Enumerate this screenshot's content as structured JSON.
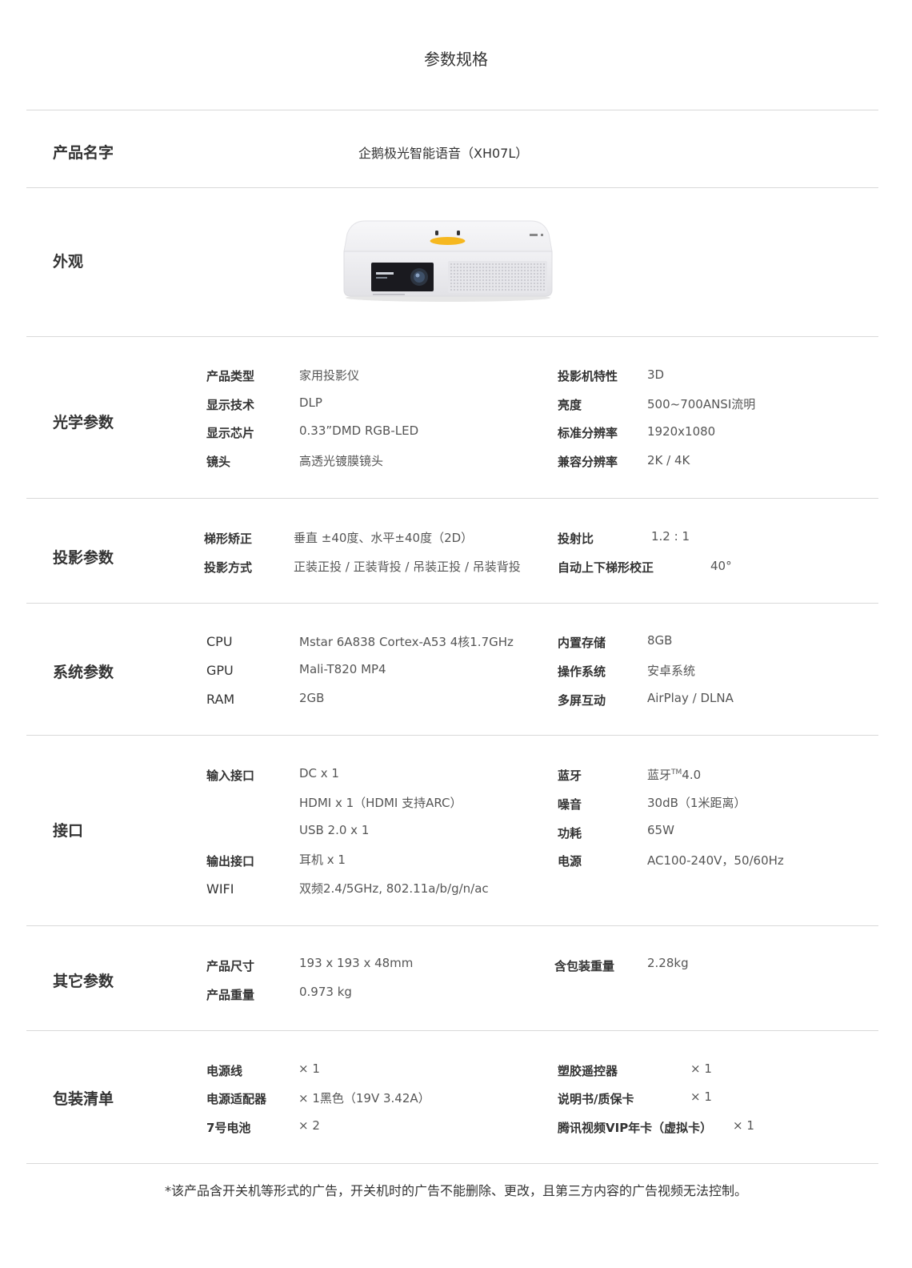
{
  "page_title": "参数规格",
  "footnote": "*该产品含开关机等形式的广告，开关机时的广告不能删除、更改，且第三方内容的广告视频无法控制。",
  "product_name": {
    "title": "产品名字",
    "value": "企鹅极光智能语音（XH07L）"
  },
  "appearance": {
    "title": "外观",
    "image_icon": "projector-image",
    "lens_label": "XGIMI"
  },
  "optical": {
    "title": "光学参数",
    "left": [
      {
        "label": "产品类型",
        "value": "家用投影仪"
      },
      {
        "label": "显示技术",
        "value": "DLP"
      },
      {
        "label": "显示芯片",
        "value": "0.33”DMD RGB-LED"
      },
      {
        "label": "镜头",
        "value": "高透光镀膜镜头"
      }
    ],
    "right": [
      {
        "label": "投影机特性",
        "value": "3D"
      },
      {
        "label": "亮度",
        "value": "500~700ANSI流明"
      },
      {
        "label": "标准分辨率",
        "value": "1920x1080"
      },
      {
        "label": "兼容分辨率",
        "value": "2K / 4K"
      }
    ]
  },
  "projection": {
    "title": "投影参数",
    "left": [
      {
        "label": "梯形矫正",
        "value": "垂直 ±40度、水平±40度（2D）"
      },
      {
        "label": "投影方式",
        "value": "正装正投 / 正装背投 / 吊装正投 / 吊装背投"
      }
    ],
    "right": [
      {
        "label": "投射比",
        "value": "1.2 : 1"
      },
      {
        "label": "自动上下梯形校正",
        "value": "40°"
      }
    ]
  },
  "system": {
    "title": "系统参数",
    "left": [
      {
        "label": "CPU",
        "value": "Mstar 6A838 Cortex-A53 4核1.7GHz"
      },
      {
        "label": "GPU",
        "value": "Mali-T820 MP4"
      },
      {
        "label": "RAM",
        "value": "2GB"
      }
    ],
    "right": [
      {
        "label": "内置存储",
        "value": "8GB"
      },
      {
        "label": "操作系统",
        "value": "安卓系统"
      },
      {
        "label": "多屏互动",
        "value": "AirPlay / DLNA"
      }
    ]
  },
  "interface": {
    "title": "接口",
    "left": [
      {
        "label": "输入接口",
        "value": "DC x 1"
      },
      {
        "label": "",
        "value": "HDMI x 1（HDMI 支持ARC）"
      },
      {
        "label": "",
        "value": "USB 2.0 x 1"
      },
      {
        "label": "输出接口",
        "value": "耳机 x 1"
      },
      {
        "label": "WIFI",
        "value": "双频2.4/5GHz, 802.11a/b/g/n/ac"
      }
    ],
    "right": [
      {
        "label": "蓝牙",
        "value": "蓝牙",
        "sup": "TM",
        "value_tail": "4.0"
      },
      {
        "label": "噪音",
        "value": "30dB（1米距离）"
      },
      {
        "label": "功耗",
        "value": "65W"
      },
      {
        "label": "电源",
        "value": "AC100-240V，50/60Hz"
      }
    ]
  },
  "other": {
    "title": "其它参数",
    "left": [
      {
        "label": "产品尺寸",
        "value": "193 x 193 x 48mm"
      },
      {
        "label": "产品重量",
        "value": "0.973 kg"
      }
    ],
    "right": [
      {
        "label": "含包装重量",
        "value": "2.28kg"
      }
    ]
  },
  "package": {
    "title": "包装清单",
    "left": [
      {
        "label": "电源线",
        "value": "× 1"
      },
      {
        "label": "电源适配器",
        "value": "× 1黑色（19V 3.42A）"
      },
      {
        "label": "7号电池",
        "value": "× 2"
      }
    ],
    "right": [
      {
        "label": "塑胶遥控器",
        "value": "× 1"
      },
      {
        "label": "说明书/质保卡",
        "value": "× 1"
      },
      {
        "label": "腾讯视频VIP年卡（虚拟卡）",
        "value": "× 1"
      }
    ]
  }
}
